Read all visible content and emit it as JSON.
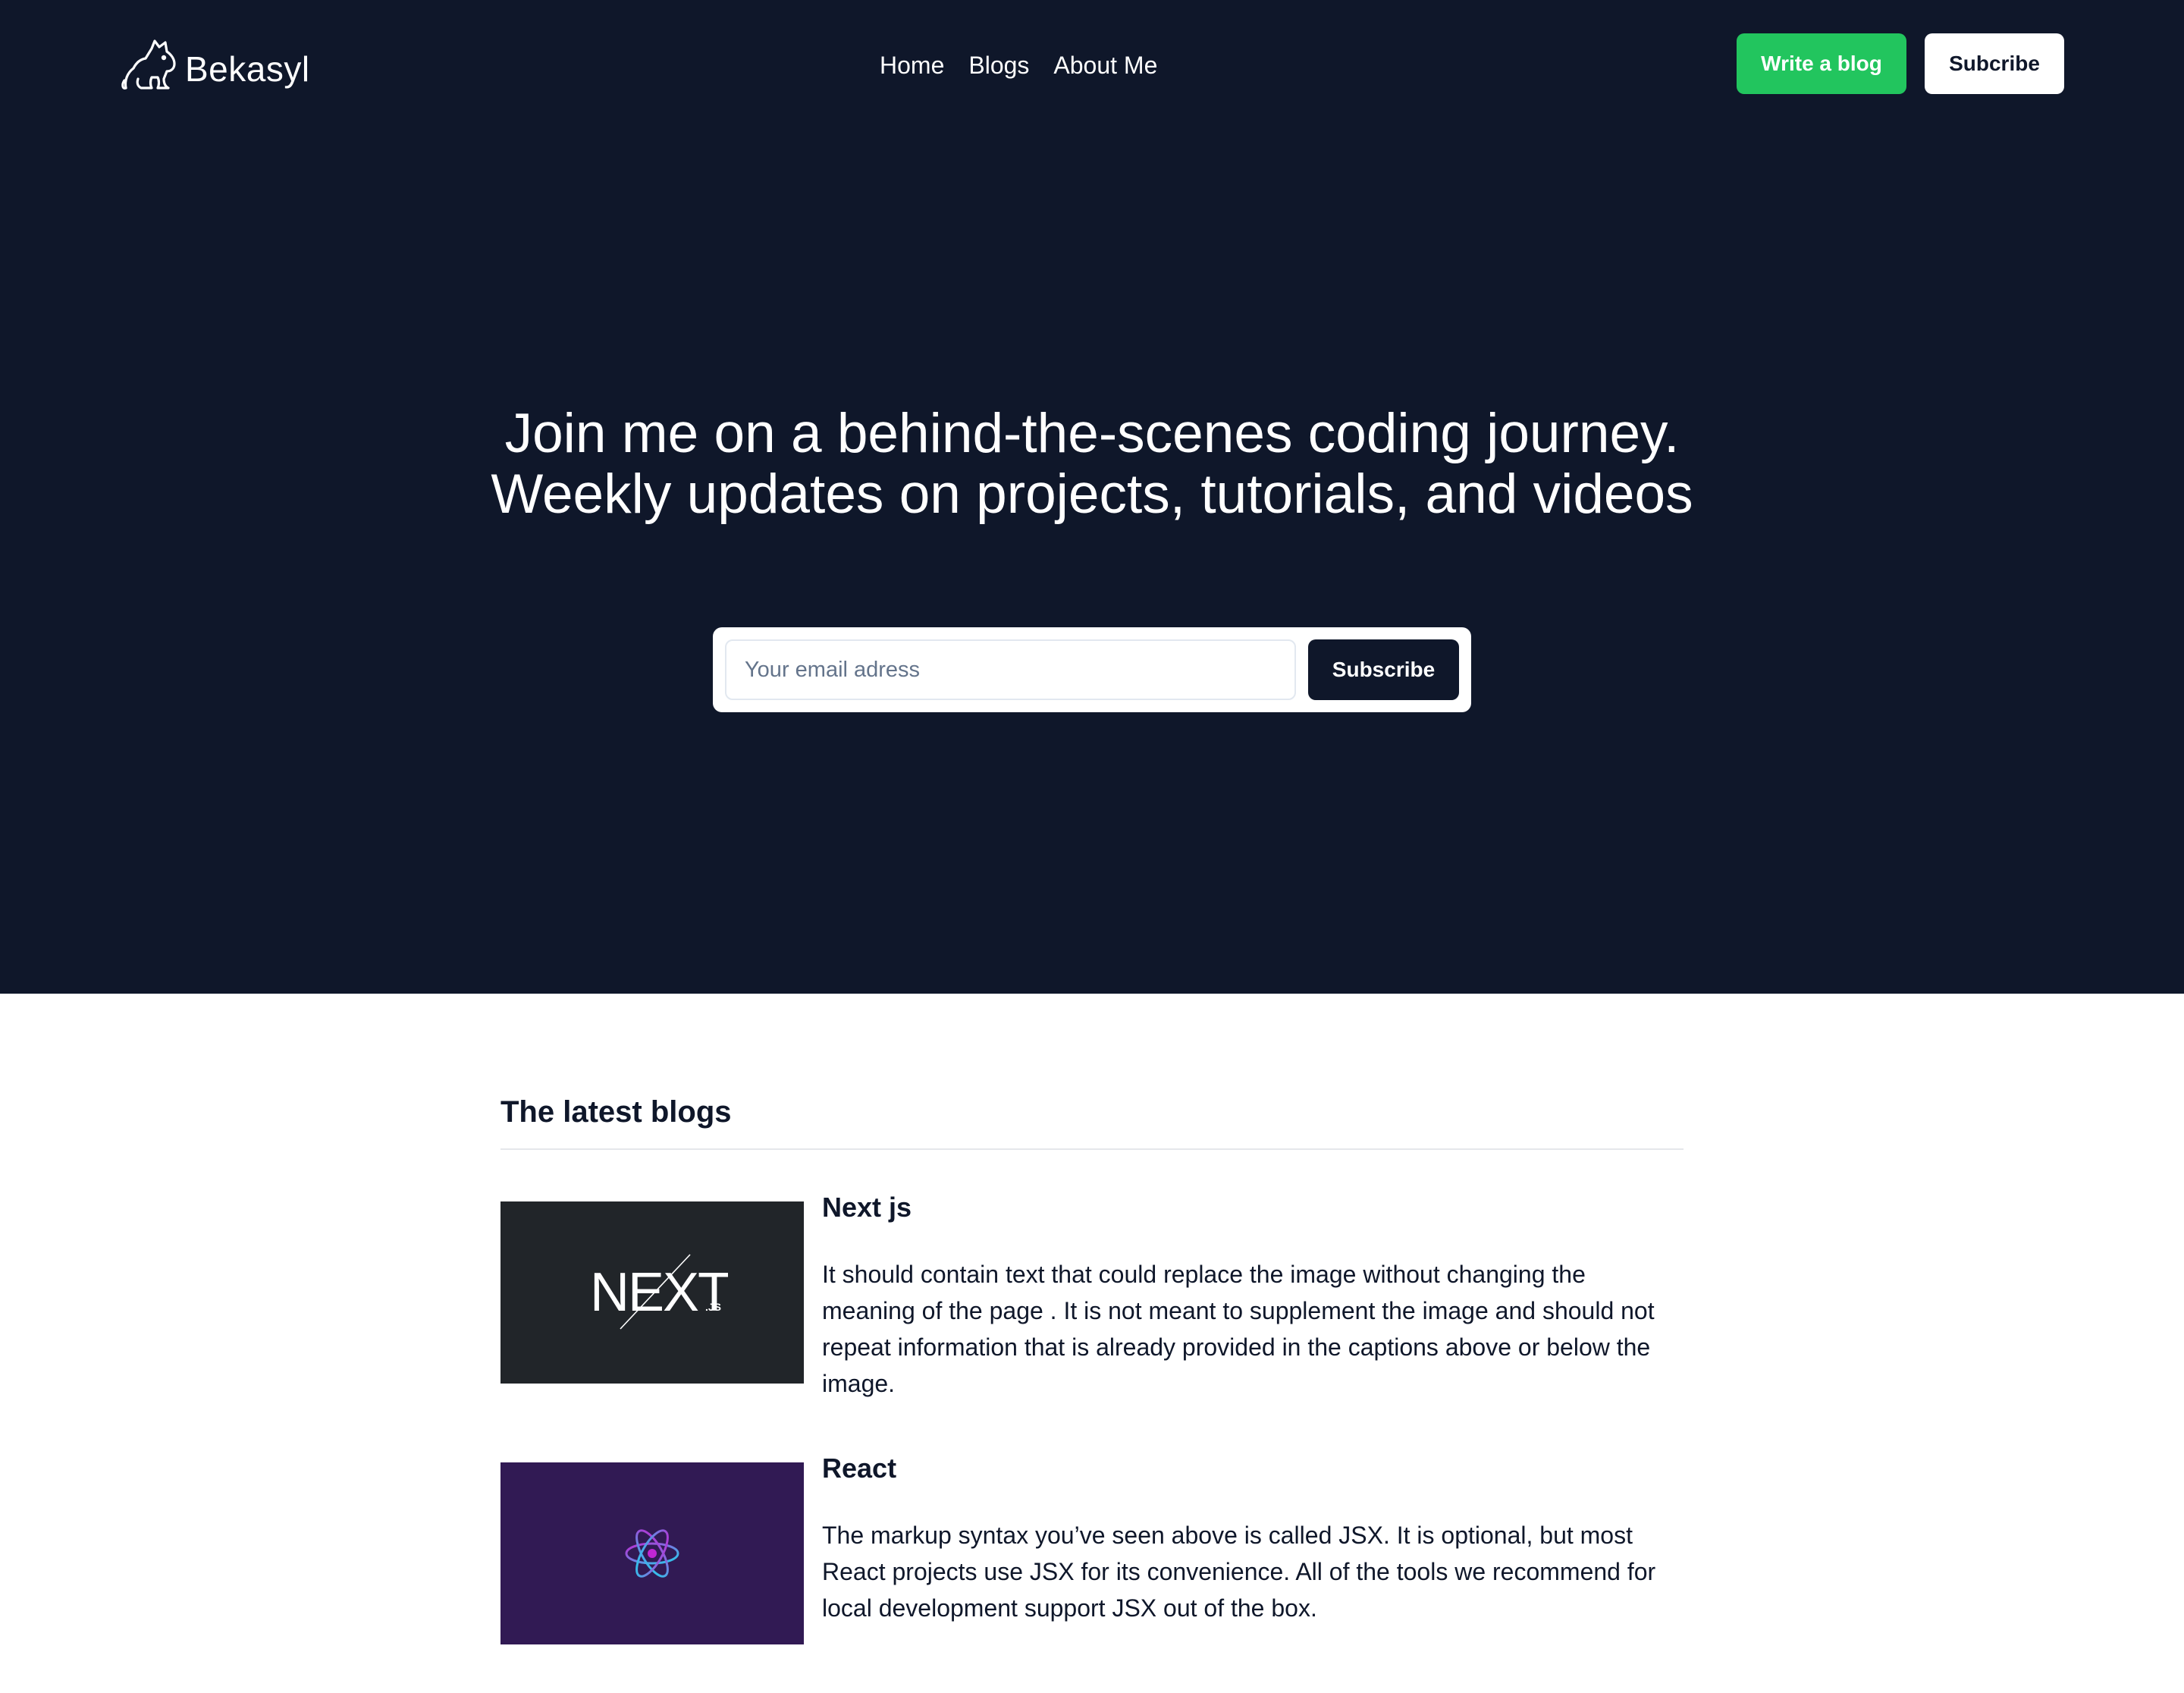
{
  "brand": {
    "name": "Bekasyl",
    "logo_icon": "cat-icon"
  },
  "nav": {
    "items": [
      "Home",
      "Blogs",
      "About Me"
    ]
  },
  "header": {
    "write_label": "Write a blog",
    "subscribe_label": "Subcribe"
  },
  "hero": {
    "title": "Join me on a behind-the-scenes coding journey. Weekly updates on projects, tutorials, and videos",
    "email_placeholder": "Your email adress",
    "subscribe_label": "Subscribe"
  },
  "blogs": {
    "section_title": "The latest blogs",
    "posts": [
      {
        "title": "Next js",
        "thumb_logo": "NEXT",
        "thumb_sub": ".JS",
        "text": "It should contain text that could replace the image without changing the meaning of the page . It is not meant to supplement the image and should not repeat information that is already provided in the captions above or below the image."
      },
      {
        "title": "React",
        "thumb_logo": "react-atom-icon",
        "text": "The markup syntax you’ve seen above is called JSX. It is optional, but most React projects use JSX for its convenience. All of the tools we recommend for local development support JSX out of the box."
      }
    ]
  },
  "colors": {
    "hero_bg": "#0f172a",
    "accent_green": "#22c55e",
    "next_thumb_bg": "#212529",
    "react_thumb_bg": "#311a54"
  }
}
